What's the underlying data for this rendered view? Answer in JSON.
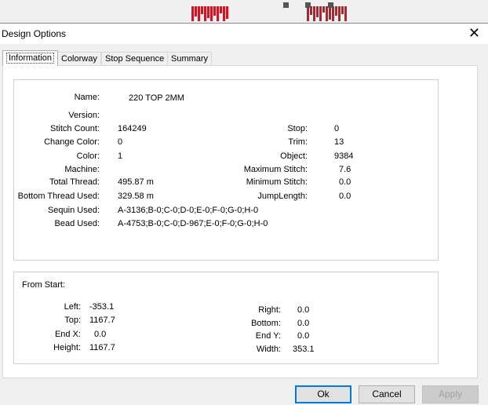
{
  "window": {
    "title": "Design Options",
    "close_glyph": "✕"
  },
  "tabs": [
    {
      "label": "Information",
      "active": true
    },
    {
      "label": "Colorway",
      "active": false
    },
    {
      "label": "Stop Sequence",
      "active": false
    },
    {
      "label": "Summary",
      "active": false
    }
  ],
  "info": {
    "name": {
      "label": "Name:",
      "value": "220 TOP 2MM"
    },
    "version": {
      "label": "Version:",
      "value": ""
    },
    "stitch_count": {
      "label": "Stitch Count:",
      "value": "164249"
    },
    "change_color": {
      "label": "Change Color:",
      "value": "0"
    },
    "color": {
      "label": "Color:",
      "value": "1"
    },
    "machine": {
      "label": "Machine:",
      "value": ""
    },
    "total_thread": {
      "label": "Total Thread:",
      "value": "495.87 m"
    },
    "bottom_thread": {
      "label": "Bottom Thread Used:",
      "value": "329.58 m"
    },
    "sequin_used": {
      "label": "Sequin Used:",
      "value": "A-3136;B-0;C-0;D-0;E-0;F-0;G-0;H-0"
    },
    "bead_used": {
      "label": "Bead Used:",
      "value": "A-4753;B-0;C-0;D-967;E-0;F-0;G-0;H-0"
    },
    "stop": {
      "label": "Stop:",
      "value": "0"
    },
    "trim": {
      "label": "Trim:",
      "value": "13"
    },
    "object": {
      "label": "Object:",
      "value": "9384"
    },
    "max_stitch": {
      "label": "Maximum Stitch:",
      "value": "7.6"
    },
    "min_stitch": {
      "label": "Minimum Stitch:",
      "value": "0.0"
    },
    "jump_length": {
      "label": "JumpLength:",
      "value": "0.0"
    }
  },
  "from_start": {
    "heading": "From Start:",
    "left": {
      "label": "Left:",
      "value": "-353.1"
    },
    "top": {
      "label": "Top:",
      "value": "1167.7"
    },
    "end_x": {
      "label": "End X:",
      "value": "0.0"
    },
    "height": {
      "label": "Height:",
      "value": "1167.7"
    },
    "right": {
      "label": "Right:",
      "value": "0.0"
    },
    "bottom": {
      "label": "Bottom:",
      "value": "0.0"
    },
    "end_y": {
      "label": "End Y:",
      "value": "0.0"
    },
    "width": {
      "label": "Width:",
      "value": "353.1"
    }
  },
  "buttons": {
    "ok": "Ok",
    "cancel": "Cancel",
    "apply": "Apply"
  }
}
